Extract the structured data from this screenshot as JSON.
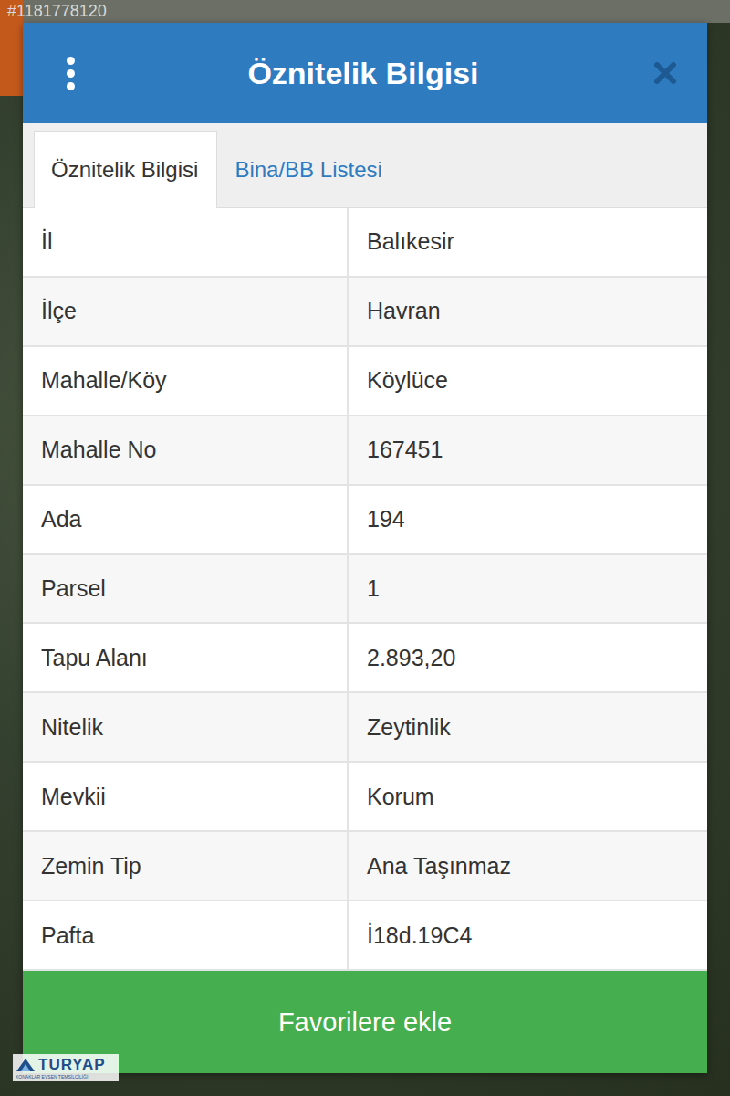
{
  "watermark": {
    "listing_id": "#1181778120"
  },
  "dialog": {
    "title": "Öznitelik Bilgisi"
  },
  "tabs": [
    {
      "label": "Öznitelik Bilgisi",
      "selected": true
    },
    {
      "label": "Bina/BB Listesi",
      "selected": false
    }
  ],
  "rows": [
    {
      "label": "İl",
      "value": "Balıkesir"
    },
    {
      "label": "İlçe",
      "value": "Havran"
    },
    {
      "label": "Mahalle/Köy",
      "value": "Köylüce"
    },
    {
      "label": "Mahalle No",
      "value": "167451"
    },
    {
      "label": "Ada",
      "value": "194"
    },
    {
      "label": "Parsel",
      "value": "1"
    },
    {
      "label": "Tapu Alanı",
      "value": "2.893,20"
    },
    {
      "label": "Nitelik",
      "value": "Zeytinlik"
    },
    {
      "label": "Mevkii",
      "value": "Korum"
    },
    {
      "label": "Zemin Tip",
      "value": "Ana Taşınmaz"
    },
    {
      "label": "Pafta",
      "value": "İ18d.19C4"
    }
  ],
  "button": {
    "label": "Favorilere ekle"
  },
  "logo": {
    "name": "TURYAP",
    "tagline": "KONAKLAR EVSEN TEMSİLCİLİĞİ"
  }
}
